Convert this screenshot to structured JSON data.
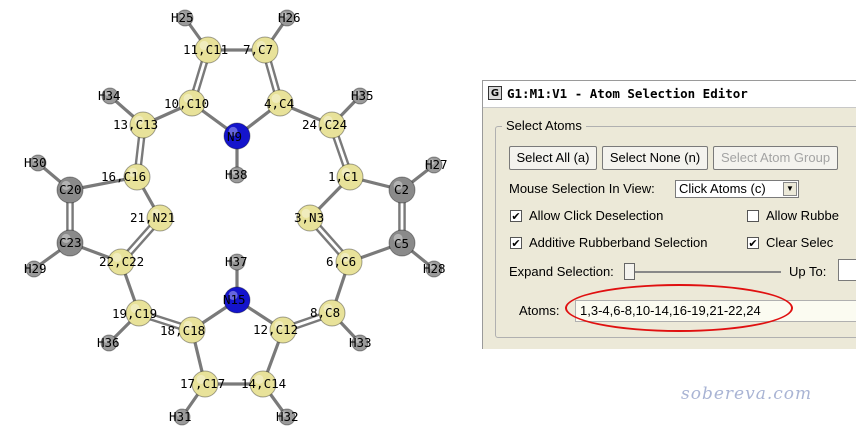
{
  "molecule": {
    "atoms": [
      {
        "label": "1,C1",
        "el": "C"
      },
      {
        "label": "C2",
        "el": "Cgray"
      },
      {
        "label": "3,N3",
        "el": "N"
      },
      {
        "label": "4,C4",
        "el": "C"
      },
      {
        "label": "C5",
        "el": "Cgray"
      },
      {
        "label": "6,C6",
        "el": "C"
      },
      {
        "label": "7,C7",
        "el": "C"
      },
      {
        "label": "8,C8",
        "el": "C"
      },
      {
        "label": "N9",
        "el": "Nsel"
      },
      {
        "label": "10,C10",
        "el": "C"
      },
      {
        "label": "11,C11",
        "el": "C"
      },
      {
        "label": "12,C12",
        "el": "C"
      },
      {
        "label": "13,C13",
        "el": "C"
      },
      {
        "label": "14,C14",
        "el": "C"
      },
      {
        "label": "N15",
        "el": "Nsel"
      },
      {
        "label": "16,C16",
        "el": "C"
      },
      {
        "label": "17,C17",
        "el": "C"
      },
      {
        "label": "18,C18",
        "el": "C"
      },
      {
        "label": "19,C19",
        "el": "C"
      },
      {
        "label": "C20",
        "el": "Cgray"
      },
      {
        "label": "21,N21",
        "el": "N"
      },
      {
        "label": "22,C22",
        "el": "C"
      },
      {
        "label": "C23",
        "el": "Cgray"
      },
      {
        "label": "24,C24",
        "el": "C"
      },
      {
        "label": "H25",
        "el": "H"
      },
      {
        "label": "H26",
        "el": "H"
      },
      {
        "label": "H27",
        "el": "H"
      },
      {
        "label": "H28",
        "el": "H"
      },
      {
        "label": "H29",
        "el": "H"
      },
      {
        "label": "H30",
        "el": "H"
      },
      {
        "label": "H31",
        "el": "H"
      },
      {
        "label": "H32",
        "el": "H"
      },
      {
        "label": "H33",
        "el": "H"
      },
      {
        "label": "H34",
        "el": "H"
      },
      {
        "label": "H35",
        "el": "H"
      },
      {
        "label": "H36",
        "el": "H"
      },
      {
        "label": "H37",
        "el": "H"
      },
      {
        "label": "H38",
        "el": "H"
      }
    ],
    "bonds": [
      [
        11,
        7
      ],
      [
        11,
        10
      ],
      [
        7,
        4
      ],
      [
        10,
        9
      ],
      [
        4,
        9
      ],
      [
        10,
        13
      ],
      [
        4,
        24
      ],
      [
        13,
        16
      ],
      [
        24,
        1
      ],
      [
        16,
        20
      ],
      [
        16,
        21
      ],
      [
        20,
        23
      ],
      [
        23,
        22
      ],
      [
        21,
        22
      ],
      [
        1,
        2
      ],
      [
        1,
        3
      ],
      [
        2,
        5
      ],
      [
        5,
        6
      ],
      [
        3,
        6
      ],
      [
        22,
        19
      ],
      [
        6,
        8
      ],
      [
        19,
        18
      ],
      [
        8,
        12
      ],
      [
        18,
        15
      ],
      [
        12,
        15
      ],
      [
        18,
        17
      ],
      [
        12,
        14
      ],
      [
        17,
        14
      ],
      [
        11,
        25
      ],
      [
        7,
        26
      ],
      [
        13,
        34
      ],
      [
        24,
        35
      ],
      [
        20,
        30
      ],
      [
        2,
        27
      ],
      [
        23,
        29
      ],
      [
        5,
        28
      ],
      [
        19,
        36
      ],
      [
        8,
        33
      ],
      [
        17,
        31
      ],
      [
        14,
        32
      ],
      [
        15,
        37
      ],
      [
        9,
        38
      ]
    ],
    "double_bonds": [
      [
        13,
        16
      ],
      [
        24,
        1
      ],
      [
        20,
        23
      ],
      [
        2,
        5
      ],
      [
        21,
        22
      ],
      [
        3,
        6
      ],
      [
        19,
        18
      ],
      [
        8,
        12
      ],
      [
        11,
        10
      ],
      [
        7,
        4
      ]
    ],
    "colors": {
      "C": "#e8e29a",
      "Cgray": "#8a8a8a",
      "N": "#e8e29a",
      "Nsel": "#1414cc",
      "H": "#9a9a9a"
    }
  },
  "dialog": {
    "title": "G1:M1:V1 - Atom Selection Editor",
    "group_label": "Select Atoms",
    "buttons": {
      "select_all": "Select All (a)",
      "select_none": "Select None (n)",
      "select_group": "Select Atom Group"
    },
    "mouse_selection_label": "Mouse Selection In View:",
    "mouse_selection_value": "Click Atoms (c)",
    "checkboxes": [
      {
        "label": "Allow Click Deselection",
        "checked": true
      },
      {
        "label": "Allow Rubbe",
        "checked": false
      },
      {
        "label": "Additive Rubberband Selection",
        "checked": true
      },
      {
        "label": "Clear Selec",
        "checked": true
      }
    ],
    "expand_label": "Expand Selection:",
    "upto_label": "Up To:",
    "atoms_label": "Atoms:",
    "atoms_value": "1,3-4,6-8,10-14,16-19,21-22,24",
    "highlight_color": "#e01010"
  },
  "watermark": "sobereva.com"
}
